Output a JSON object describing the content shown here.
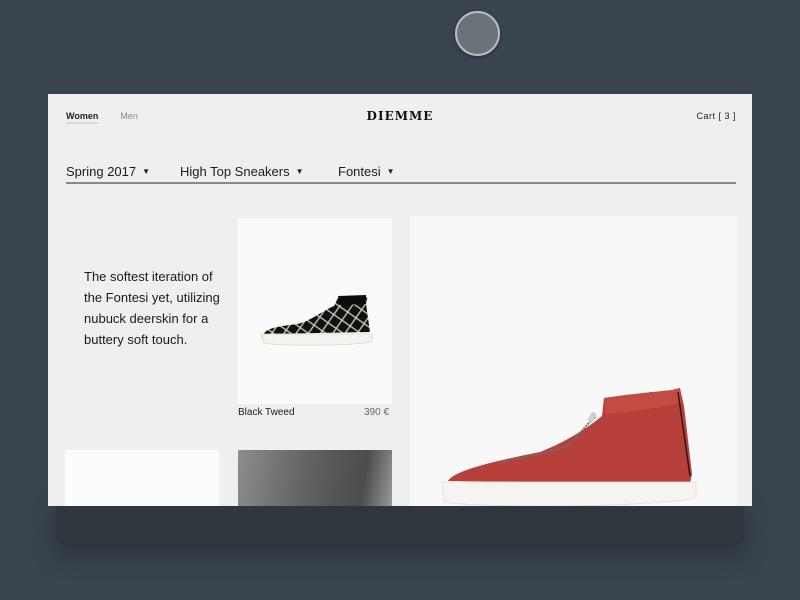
{
  "header": {
    "brand": "DIEMME",
    "nav": [
      {
        "label": "Women",
        "active": true
      },
      {
        "label": "Men",
        "active": false
      }
    ],
    "cart_label": "Cart [ 3 ]"
  },
  "filters": [
    {
      "label": "Spring 2017",
      "icon": "caret-down-icon"
    },
    {
      "label": "High Top Sneakers",
      "icon": "caret-down-icon"
    },
    {
      "label": "Fontesi",
      "icon": "caret-down-icon"
    }
  ],
  "caret": "▼",
  "description": "The softest iteration of the Fontesi yet, utilizing nubuck deerskin for a buttery soft touch.",
  "products": [
    {
      "name": "Black Tweed",
      "price": "390 €",
      "image": "black-tweed-sneaker"
    },
    {
      "name": "",
      "price": "",
      "image": "red-zip-sneaker"
    }
  ],
  "colors": {
    "background": "#3a444d",
    "page": "#efefef",
    "accent_red": "#b8403a"
  }
}
